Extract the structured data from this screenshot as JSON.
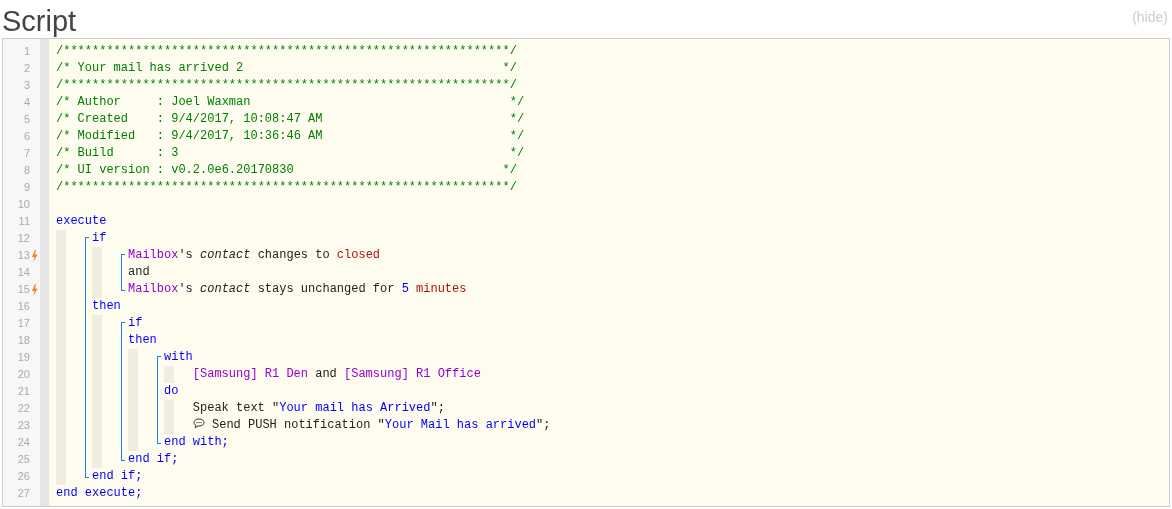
{
  "title": "Script",
  "hide_link": "(hide)",
  "lines": [
    {
      "number": "1",
      "trigger": false,
      "tokens": [
        {
          "kind": "comment",
          "text": "/**************************************************************/"
        }
      ]
    },
    {
      "number": "2",
      "trigger": false,
      "tokens": [
        {
          "kind": "comment",
          "text": "/* Your mail has arrived 2                                    */"
        }
      ]
    },
    {
      "number": "3",
      "trigger": false,
      "tokens": [
        {
          "kind": "comment",
          "text": "/**************************************************************/"
        }
      ]
    },
    {
      "number": "4",
      "trigger": false,
      "tokens": [
        {
          "kind": "comment",
          "text": "/* Author     : Joel Waxman                                    */"
        }
      ]
    },
    {
      "number": "5",
      "trigger": false,
      "tokens": [
        {
          "kind": "comment",
          "text": "/* Created    : 9/4/2017, 10:08:47 AM                          */"
        }
      ]
    },
    {
      "number": "6",
      "trigger": false,
      "tokens": [
        {
          "kind": "comment",
          "text": "/* Modified   : 9/4/2017, 10:36:46 AM                          */"
        }
      ]
    },
    {
      "number": "7",
      "trigger": false,
      "tokens": [
        {
          "kind": "comment",
          "text": "/* Build      : 3                                              */"
        }
      ]
    },
    {
      "number": "8",
      "trigger": false,
      "tokens": [
        {
          "kind": "comment",
          "text": "/* UI version : v0.2.0e6.20170830                             */"
        }
      ]
    },
    {
      "number": "9",
      "trigger": false,
      "tokens": [
        {
          "kind": "comment",
          "text": "/**************************************************************/"
        }
      ]
    },
    {
      "number": "10",
      "trigger": false
    },
    {
      "number": "11",
      "trigger": false,
      "tokens": [
        {
          "kind": "keyword",
          "text": "execute"
        }
      ]
    },
    {
      "number": "12",
      "trigger": false,
      "tokens": [
        {
          "kind": "keyword",
          "text": "     if"
        }
      ]
    },
    {
      "number": "13",
      "trigger": true,
      "tokens": [
        {
          "kind": "device",
          "text": "          Mailbox"
        },
        {
          "kind": "plain",
          "text": "'s "
        },
        {
          "kind": "attribute",
          "text": "contact"
        },
        {
          "kind": "plain",
          "text": " changes to "
        },
        {
          "kind": "value",
          "text": "closed"
        }
      ]
    },
    {
      "number": "14",
      "trigger": false,
      "tokens": [
        {
          "kind": "plain",
          "text": "          and"
        }
      ]
    },
    {
      "number": "15",
      "trigger": true,
      "tokens": [
        {
          "kind": "device",
          "text": "          Mailbox"
        },
        {
          "kind": "plain",
          "text": "'s "
        },
        {
          "kind": "attribute",
          "text": "contact"
        },
        {
          "kind": "plain",
          "text": " stays unchanged for "
        },
        {
          "kind": "number",
          "text": "5"
        },
        {
          "kind": "value",
          "text": " minutes"
        }
      ]
    },
    {
      "number": "16",
      "trigger": false,
      "tokens": [
        {
          "kind": "keyword",
          "text": "     then"
        }
      ]
    },
    {
      "number": "17",
      "trigger": false,
      "tokens": [
        {
          "kind": "keyword",
          "text": "          if"
        }
      ]
    },
    {
      "number": "18",
      "trigger": false,
      "tokens": [
        {
          "kind": "keyword",
          "text": "          then"
        }
      ]
    },
    {
      "number": "19",
      "trigger": false,
      "tokens": [
        {
          "kind": "keyword",
          "text": "               with"
        }
      ]
    },
    {
      "number": "20",
      "trigger": false,
      "tokens": [
        {
          "kind": "device",
          "text": "                   [Samsung] R1 Den"
        },
        {
          "kind": "plain",
          "text": " and "
        },
        {
          "kind": "device",
          "text": "[Samsung] R1 Office"
        }
      ]
    },
    {
      "number": "21",
      "trigger": false,
      "tokens": [
        {
          "kind": "keyword",
          "text": "               do"
        }
      ]
    },
    {
      "number": "22",
      "trigger": false,
      "tokens": [
        {
          "kind": "plain",
          "text": "                   Speak text \""
        },
        {
          "kind": "string",
          "text": "Your mail has Arrived"
        },
        {
          "kind": "plain",
          "text": "\";"
        }
      ]
    },
    {
      "number": "23",
      "trigger": false,
      "tokens": [
        {
          "kind": "chat-icon"
        },
        {
          "kind": "plain",
          "text": " Send PUSH notification \""
        },
        {
          "kind": "string",
          "text": "Your Mail has arrived"
        },
        {
          "kind": "plain",
          "text": "\";"
        }
      ]
    },
    {
      "number": "24",
      "trigger": false,
      "tokens": [
        {
          "kind": "keyword",
          "text": "               end with;"
        }
      ]
    },
    {
      "number": "25",
      "trigger": false,
      "tokens": [
        {
          "kind": "keyword",
          "text": "          end if;"
        }
      ]
    },
    {
      "number": "26",
      "trigger": false,
      "tokens": [
        {
          "kind": "keyword",
          "text": "     end if;"
        }
      ]
    },
    {
      "number": "27",
      "trigger": false,
      "tokens": [
        {
          "kind": "keyword",
          "text": "end execute;"
        }
      ]
    }
  ]
}
